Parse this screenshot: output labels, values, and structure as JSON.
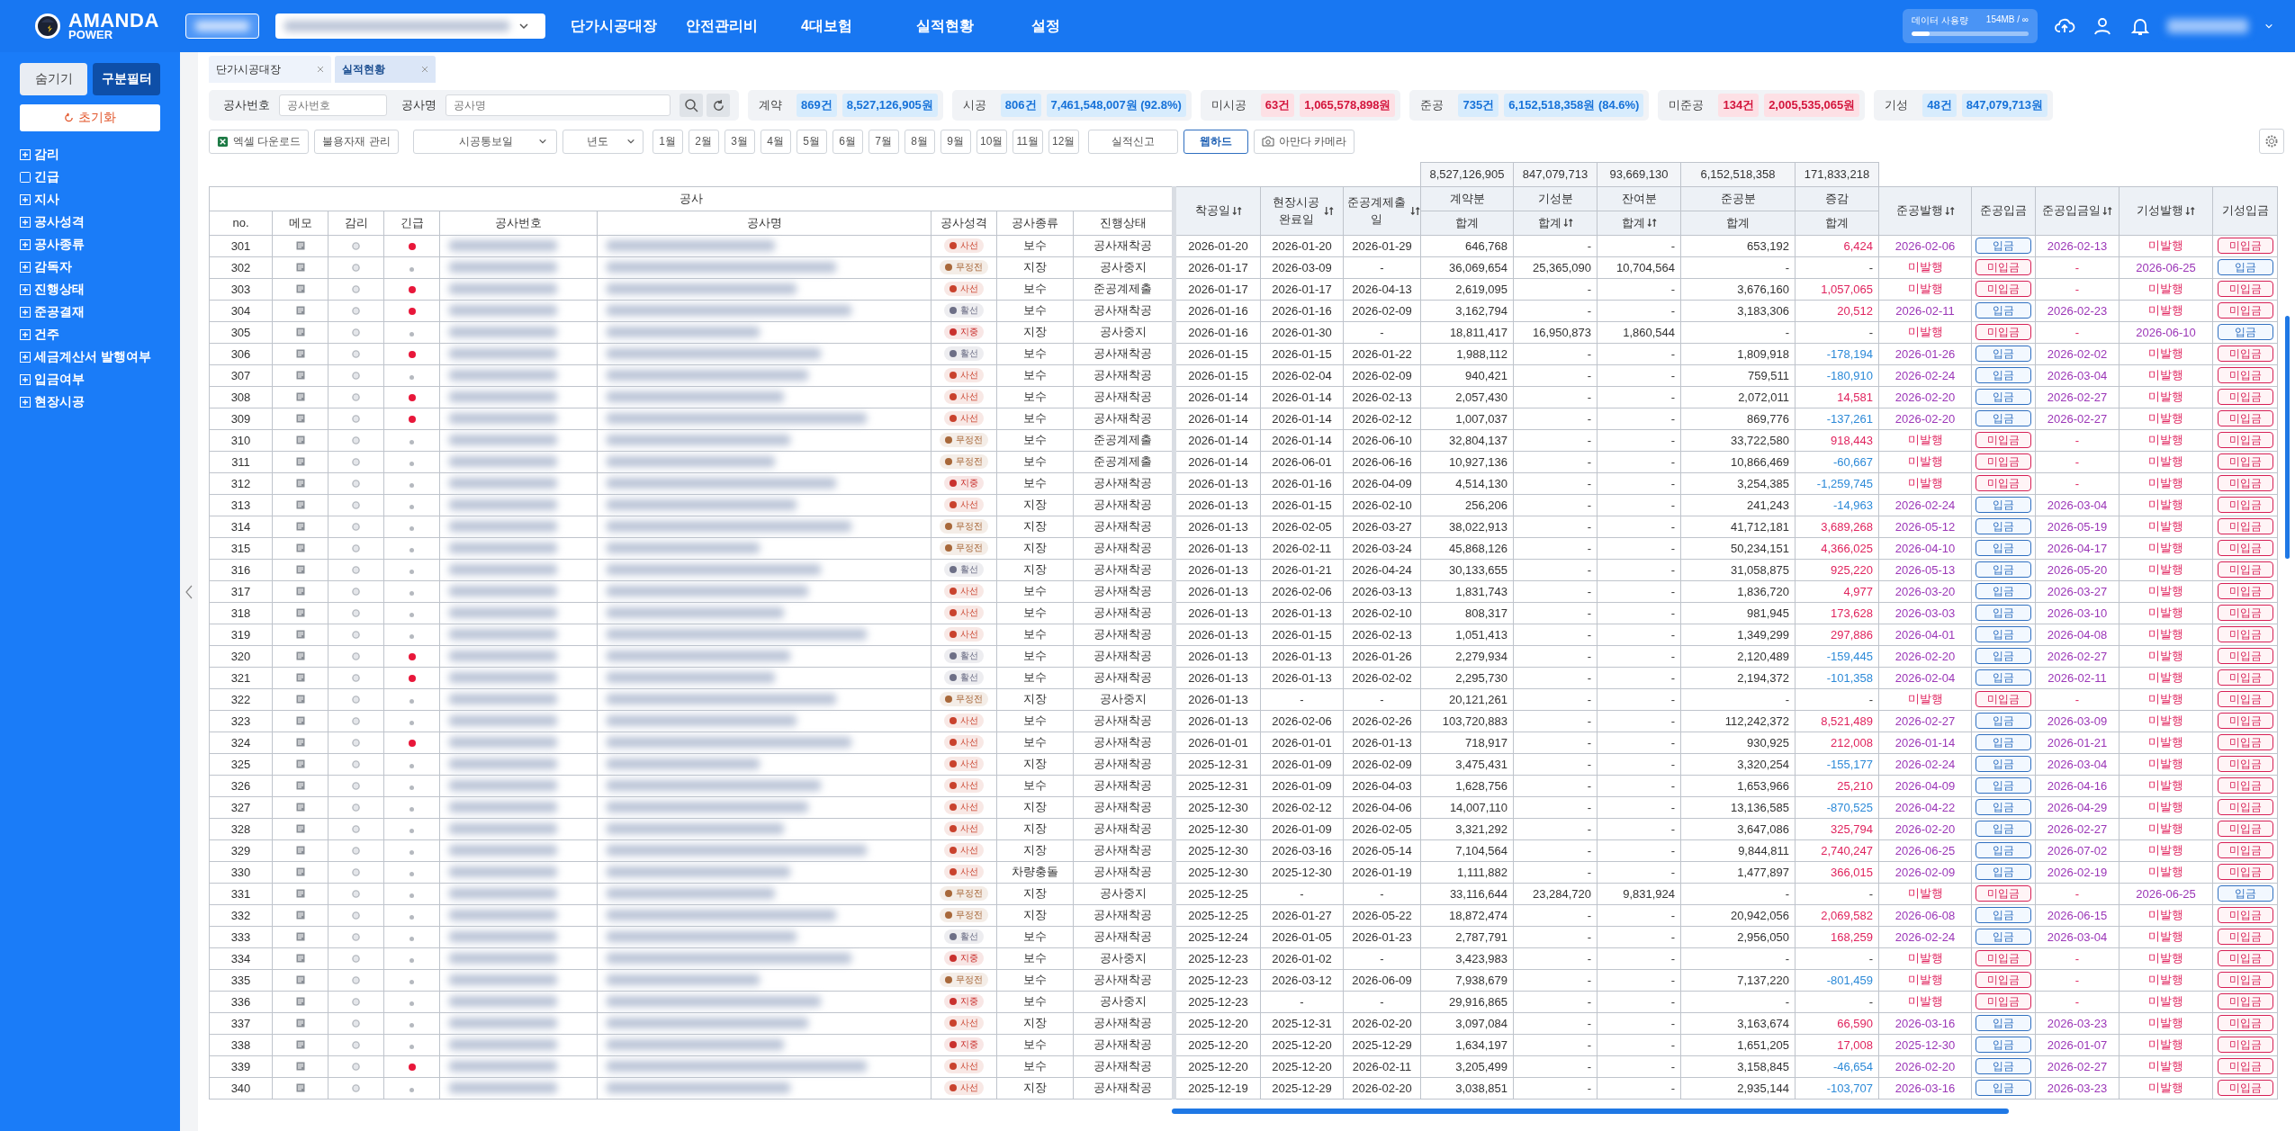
{
  "header": {
    "logo_title": "AMANDA",
    "logo_subtitle": "POWER",
    "nav": [
      "단가시공대장",
      "안전관리비",
      "4대보험",
      "실적현황",
      "설정"
    ],
    "usage": {
      "label": "데이터 사용량",
      "value": "154MB / ∞",
      "level": 0.15
    }
  },
  "sidebar": {
    "buttons": [
      {
        "label": "숨기기",
        "selected": false
      },
      {
        "label": "구분필터",
        "selected": true
      }
    ],
    "reset": "초기화",
    "items": [
      {
        "label": "감리",
        "kind": "group"
      },
      {
        "label": "긴급",
        "kind": "checkbox",
        "checked": false
      },
      {
        "label": "지사",
        "kind": "group"
      },
      {
        "label": "공사성격",
        "kind": "group"
      },
      {
        "label": "공사종류",
        "kind": "group"
      },
      {
        "label": "감독자",
        "kind": "group"
      },
      {
        "label": "진행상태",
        "kind": "group"
      },
      {
        "label": "준공결재",
        "kind": "group"
      },
      {
        "label": "건주",
        "kind": "group"
      },
      {
        "label": "세금계산서 발행여부",
        "kind": "group"
      },
      {
        "label": "입금여부",
        "kind": "group"
      },
      {
        "label": "현장시공",
        "kind": "group"
      }
    ]
  },
  "tabs": [
    {
      "label": "단가시공대장",
      "selected": false
    },
    {
      "label": "실적현황",
      "selected": true
    }
  ],
  "search": {
    "fields": [
      {
        "label": "공사번호",
        "placeholder": "공사번호"
      },
      {
        "label": "공사명",
        "placeholder": "공사명"
      }
    ]
  },
  "stats": [
    {
      "label": "계약",
      "count": "869건",
      "amount": "8,527,126,905원",
      "alert": false
    },
    {
      "label": "시공",
      "count": "806건",
      "amount": "7,461,548,007원 (92.8%)",
      "alert": false
    },
    {
      "label": "미시공",
      "count": "63건",
      "amount": "1,065,578,898원",
      "alert": true
    },
    {
      "label": "준공",
      "count": "735건",
      "amount": "6,152,518,358원 (84.6%)",
      "alert": false
    },
    {
      "label": "미준공",
      "count": "134건",
      "amount": "2,005,535,065원",
      "alert": true
    },
    {
      "label": "기성",
      "count": "48건",
      "amount": "847,079,713원",
      "alert": false
    }
  ],
  "toolbar": {
    "excel": "엑셀 다운로드",
    "materials": "불용자재 관리",
    "date_select": "시공통보일",
    "year_select": "년도",
    "months": [
      "1월",
      "2월",
      "3월",
      "4월",
      "5월",
      "6월",
      "7월",
      "8월",
      "9월",
      "10월",
      "11월",
      "12월"
    ],
    "report": "실적신고",
    "webhard": "웹하드",
    "camera": "아만다 카메라"
  },
  "table": {
    "group_label": "공사",
    "left_columns": [
      "no.",
      "메모",
      "감리",
      "긴급",
      "공사번호",
      "공사명",
      "공사성격",
      "공사종류",
      "진행상태"
    ],
    "date_columns": [
      {
        "label": "착공일",
        "sortable": true
      },
      {
        "label": "현장시공 완료일",
        "sortable": true
      },
      {
        "label": "준공계제출일",
        "sortable": true
      }
    ],
    "amount_columns": [
      {
        "label": "계약분",
        "total": "8,527,126,905",
        "sub_label": "합계",
        "sortable": false
      },
      {
        "label": "기성분",
        "total": "847,079,713",
        "sub_label": "합계",
        "sortable": true
      },
      {
        "label": "잔여분",
        "total": "93,669,130",
        "sub_label": "합계",
        "sortable": true
      },
      {
        "label": "준공분",
        "total": "6,152,518,358",
        "sub_label": "합계",
        "sortable": false
      },
      {
        "label": "증감",
        "total": "171,833,218",
        "sub_label": "합계",
        "sortable": false
      }
    ],
    "status_columns": [
      {
        "label": "준공발행",
        "sortable": true
      },
      {
        "label": "준공입금",
        "sortable": false
      },
      {
        "label": "준공입금일",
        "sortable": true
      },
      {
        "label": "기성발행",
        "sortable": true
      },
      {
        "label": "기성입금",
        "sortable": false
      }
    ],
    "rows": [
      {
        "no": "301",
        "urgent": true,
        "nature": {
          "label": "사선",
          "color": "#c9422d"
        },
        "type": "보수",
        "status": "공사재착공",
        "start": "2026-01-20",
        "site_done": "2026-01-20",
        "report_date": "2026-01-29",
        "contract": "646,768",
        "progress_amt": "-",
        "remaining": "-",
        "completed_amt": "653,192",
        "change": {
          "text": "6,424",
          "kind": "increase"
        },
        "comp_issue": "2026-02-06",
        "comp_issued": true,
        "comp_deposit": "입금",
        "comp_deposited": true,
        "comp_deposit_date": "2026-02-13",
        "prog_issue": "미발행",
        "prog_issued": false,
        "prog_deposit": "미입금",
        "prog_deposited": false
      },
      {
        "no": "302",
        "urgent": false,
        "nature": {
          "label": "무정전",
          "color": "#a8683a"
        },
        "type": "지장",
        "status": "공사중지",
        "start": "2026-01-17",
        "site_done": "2026-03-09",
        "report_date": "-",
        "contract": "36,069,654",
        "progress_amt": "25,365,090",
        "remaining": "10,704,564",
        "completed_amt": "-",
        "change": {
          "text": "-",
          "kind": "none"
        },
        "comp_issue": "미발행",
        "comp_issued": false,
        "comp_deposit": "미입금",
        "comp_deposited": false,
        "comp_deposit_date": "-",
        "prog_issue": "2026-06-25",
        "prog_issued": true,
        "prog_deposit": "입금",
        "prog_deposited": true
      },
      {
        "no": "303",
        "urgent": true,
        "nature": {
          "label": "사선",
          "color": "#c9422d"
        },
        "type": "보수",
        "status": "준공계제출",
        "start": "2026-01-17",
        "site_done": "2026-01-17",
        "report_date": "2026-04-13",
        "contract": "2,619,095",
        "progress_amt": "-",
        "remaining": "-",
        "completed_amt": "3,676,160",
        "change": {
          "text": "1,057,065",
          "kind": "increase"
        },
        "comp_issue": "미발행",
        "comp_issued": false,
        "comp_deposit": "미입금",
        "comp_deposited": false,
        "comp_deposit_date": "-",
        "prog_issue": "미발행",
        "prog_issued": false,
        "prog_deposit": "미입금",
        "prog_deposited": false
      },
      {
        "no": "304",
        "urgent": true,
        "nature": {
          "label": "활선",
          "color": "#6d6f86"
        },
        "type": "보수",
        "status": "공사재착공",
        "start": "2026-01-16",
        "site_done": "2026-01-16",
        "report_date": "2026-02-09",
        "contract": "3,162,794",
        "progress_amt": "-",
        "remaining": "-",
        "completed_amt": "3,183,306",
        "change": {
          "text": "20,512",
          "kind": "increase"
        },
        "comp_issue": "2026-02-11",
        "comp_issued": true,
        "comp_deposit": "입금",
        "comp_deposited": true,
        "comp_deposit_date": "2026-02-23",
        "prog_issue": "미발행",
        "prog_issued": false,
        "prog_deposit": "미입금",
        "prog_deposited": false
      },
      {
        "no": "305",
        "urgent": false,
        "nature": {
          "label": "지중",
          "color": "#c9302d"
        },
        "type": "지장",
        "status": "공사중지",
        "start": "2026-01-16",
        "site_done": "2026-01-30",
        "report_date": "-",
        "contract": "18,811,417",
        "progress_amt": "16,950,873",
        "remaining": "1,860,544",
        "completed_amt": "-",
        "change": {
          "text": "-",
          "kind": "none"
        },
        "comp_issue": "미발행",
        "comp_issued": false,
        "comp_deposit": "미입금",
        "comp_deposited": false,
        "comp_deposit_date": "-",
        "prog_issue": "2026-06-10",
        "prog_issued": true,
        "prog_deposit": "입금",
        "prog_deposited": true
      },
      {
        "no": "306",
        "urgent": true,
        "nature": {
          "label": "활선",
          "color": "#6d6f86"
        },
        "type": "보수",
        "status": "공사재착공",
        "start": "2026-01-15",
        "site_done": "2026-01-15",
        "report_date": "2026-01-22",
        "contract": "1,988,112",
        "progress_amt": "-",
        "remaining": "-",
        "completed_amt": "1,809,918",
        "change": {
          "text": "-178,194",
          "kind": "decrease"
        },
        "comp_issue": "2026-01-26",
        "comp_issued": true,
        "comp_deposit": "입금",
        "comp_deposited": true,
        "comp_deposit_date": "2026-02-02",
        "prog_issue": "미발행",
        "prog_issued": false,
        "prog_deposit": "미입금",
        "prog_deposited": false
      },
      {
        "no": "307",
        "urgent": false,
        "nature": {
          "label": "사선",
          "color": "#c9422d"
        },
        "type": "보수",
        "status": "공사재착공",
        "start": "2026-01-15",
        "site_done": "2026-02-04",
        "report_date": "2026-02-09",
        "contract": "940,421",
        "progress_amt": "-",
        "remaining": "-",
        "completed_amt": "759,511",
        "change": {
          "text": "-180,910",
          "kind": "decrease"
        },
        "comp_issue": "2026-02-24",
        "comp_issued": true,
        "comp_deposit": "입금",
        "comp_deposited": true,
        "comp_deposit_date": "2026-03-04",
        "prog_issue": "미발행",
        "prog_issued": false,
        "prog_deposit": "미입금",
        "prog_deposited": false
      },
      {
        "no": "308",
        "urgent": true,
        "nature": {
          "label": "사선",
          "color": "#c9422d"
        },
        "type": "보수",
        "status": "공사재착공",
        "start": "2026-01-14",
        "site_done": "2026-01-14",
        "report_date": "2026-02-13",
        "contract": "2,057,430",
        "progress_amt": "-",
        "remaining": "-",
        "completed_amt": "2,072,011",
        "change": {
          "text": "14,581",
          "kind": "increase"
        },
        "comp_issue": "2026-02-20",
        "comp_issued": true,
        "comp_deposit": "입금",
        "comp_deposited": true,
        "comp_deposit_date": "2026-02-27",
        "prog_issue": "미발행",
        "prog_issued": false,
        "prog_deposit": "미입금",
        "prog_deposited": false
      },
      {
        "no": "309",
        "urgent": true,
        "nature": {
          "label": "사선",
          "color": "#c9422d"
        },
        "type": "보수",
        "status": "공사재착공",
        "start": "2026-01-14",
        "site_done": "2026-01-14",
        "report_date": "2026-02-12",
        "contract": "1,007,037",
        "progress_amt": "-",
        "remaining": "-",
        "completed_amt": "869,776",
        "change": {
          "text": "-137,261",
          "kind": "decrease"
        },
        "comp_issue": "2026-02-20",
        "comp_issued": true,
        "comp_deposit": "입금",
        "comp_deposited": true,
        "comp_deposit_date": "2026-02-27",
        "prog_issue": "미발행",
        "prog_issued": false,
        "prog_deposit": "미입금",
        "prog_deposited": false
      },
      {
        "no": "310",
        "urgent": false,
        "nature": {
          "label": "무정전",
          "color": "#a8683a"
        },
        "type": "보수",
        "status": "준공계제출",
        "start": "2026-01-14",
        "site_done": "2026-01-14",
        "report_date": "2026-06-10",
        "contract": "32,804,137",
        "progress_amt": "-",
        "remaining": "-",
        "completed_amt": "33,722,580",
        "change": {
          "text": "918,443",
          "kind": "increase"
        },
        "comp_issue": "미발행",
        "comp_issued": false,
        "comp_deposit": "미입금",
        "comp_deposited": false,
        "comp_deposit_date": "-",
        "prog_issue": "미발행",
        "prog_issued": false,
        "prog_deposit": "미입금",
        "prog_deposited": false
      },
      {
        "no": "311",
        "urgent": false,
        "nature": {
          "label": "무정전",
          "color": "#a8683a"
        },
        "type": "보수",
        "status": "준공계제출",
        "start": "2026-01-14",
        "site_done": "2026-06-01",
        "report_date": "2026-06-16",
        "contract": "10,927,136",
        "progress_amt": "-",
        "remaining": "-",
        "completed_amt": "10,866,469",
        "change": {
          "text": "-60,667",
          "kind": "decrease"
        },
        "comp_issue": "미발행",
        "comp_issued": false,
        "comp_deposit": "미입금",
        "comp_deposited": false,
        "comp_deposit_date": "-",
        "prog_issue": "미발행",
        "prog_issued": false,
        "prog_deposit": "미입금",
        "prog_deposited": false
      },
      {
        "no": "312",
        "urgent": false,
        "nature": {
          "label": "지중",
          "color": "#c9302d"
        },
        "type": "보수",
        "status": "공사재착공",
        "start": "2026-01-13",
        "site_done": "2026-01-16",
        "report_date": "2026-04-09",
        "contract": "4,514,130",
        "progress_amt": "-",
        "remaining": "-",
        "completed_amt": "3,254,385",
        "change": {
          "text": "-1,259,745",
          "kind": "decrease"
        },
        "comp_issue": "미발행",
        "comp_issued": false,
        "comp_deposit": "미입금",
        "comp_deposited": false,
        "comp_deposit_date": "-",
        "prog_issue": "미발행",
        "prog_issued": false,
        "prog_deposit": "미입금",
        "prog_deposited": false
      },
      {
        "no": "313",
        "urgent": false,
        "nature": {
          "label": "사선",
          "color": "#c9422d"
        },
        "type": "지장",
        "status": "공사재착공",
        "start": "2026-01-13",
        "site_done": "2026-01-15",
        "report_date": "2026-02-10",
        "contract": "256,206",
        "progress_amt": "-",
        "remaining": "-",
        "completed_amt": "241,243",
        "change": {
          "text": "-14,963",
          "kind": "decrease"
        },
        "comp_issue": "2026-02-24",
        "comp_issued": true,
        "comp_deposit": "입금",
        "comp_deposited": true,
        "comp_deposit_date": "2026-03-04",
        "prog_issue": "미발행",
        "prog_issued": false,
        "prog_deposit": "미입금",
        "prog_deposited": false
      },
      {
        "no": "314",
        "urgent": false,
        "nature": {
          "label": "무정전",
          "color": "#a8683a"
        },
        "type": "지장",
        "status": "공사재착공",
        "start": "2026-01-13",
        "site_done": "2026-02-05",
        "report_date": "2026-03-27",
        "contract": "38,022,913",
        "progress_amt": "-",
        "remaining": "-",
        "completed_amt": "41,712,181",
        "change": {
          "text": "3,689,268",
          "kind": "increase"
        },
        "comp_issue": "2026-05-12",
        "comp_issued": true,
        "comp_deposit": "입금",
        "comp_deposited": true,
        "comp_deposit_date": "2026-05-19",
        "prog_issue": "미발행",
        "prog_issued": false,
        "prog_deposit": "미입금",
        "prog_deposited": false
      },
      {
        "no": "315",
        "urgent": false,
        "nature": {
          "label": "무정전",
          "color": "#a8683a"
        },
        "type": "지장",
        "status": "공사재착공",
        "start": "2026-01-13",
        "site_done": "2026-02-11",
        "report_date": "2026-03-24",
        "contract": "45,868,126",
        "progress_amt": "-",
        "remaining": "-",
        "completed_amt": "50,234,151",
        "change": {
          "text": "4,366,025",
          "kind": "increase"
        },
        "comp_issue": "2026-04-10",
        "comp_issued": true,
        "comp_deposit": "입금",
        "comp_deposited": true,
        "comp_deposit_date": "2026-04-17",
        "prog_issue": "미발행",
        "prog_issued": false,
        "prog_deposit": "미입금",
        "prog_deposited": false
      },
      {
        "no": "316",
        "urgent": false,
        "nature": {
          "label": "활선",
          "color": "#6d6f86"
        },
        "type": "지장",
        "status": "공사재착공",
        "start": "2026-01-13",
        "site_done": "2026-01-21",
        "report_date": "2026-04-24",
        "contract": "30,133,655",
        "progress_amt": "-",
        "remaining": "-",
        "completed_amt": "31,058,875",
        "change": {
          "text": "925,220",
          "kind": "increase"
        },
        "comp_issue": "2026-05-13",
        "comp_issued": true,
        "comp_deposit": "입금",
        "comp_deposited": true,
        "comp_deposit_date": "2026-05-20",
        "prog_issue": "미발행",
        "prog_issued": false,
        "prog_deposit": "미입금",
        "prog_deposited": false
      },
      {
        "no": "317",
        "urgent": false,
        "nature": {
          "label": "사선",
          "color": "#c9422d"
        },
        "type": "보수",
        "status": "공사재착공",
        "start": "2026-01-13",
        "site_done": "2026-02-06",
        "report_date": "2026-03-13",
        "contract": "1,831,743",
        "progress_amt": "-",
        "remaining": "-",
        "completed_amt": "1,836,720",
        "change": {
          "text": "4,977",
          "kind": "increase"
        },
        "comp_issue": "2026-03-20",
        "comp_issued": true,
        "comp_deposit": "입금",
        "comp_deposited": true,
        "comp_deposit_date": "2026-03-27",
        "prog_issue": "미발행",
        "prog_issued": false,
        "prog_deposit": "미입금",
        "prog_deposited": false
      },
      {
        "no": "318",
        "urgent": false,
        "nature": {
          "label": "사선",
          "color": "#c9422d"
        },
        "type": "보수",
        "status": "공사재착공",
        "start": "2026-01-13",
        "site_done": "2026-01-13",
        "report_date": "2026-02-10",
        "contract": "808,317",
        "progress_amt": "-",
        "remaining": "-",
        "completed_amt": "981,945",
        "change": {
          "text": "173,628",
          "kind": "increase"
        },
        "comp_issue": "2026-03-03",
        "comp_issued": true,
        "comp_deposit": "입금",
        "comp_deposited": true,
        "comp_deposit_date": "2026-03-10",
        "prog_issue": "미발행",
        "prog_issued": false,
        "prog_deposit": "미입금",
        "prog_deposited": false
      },
      {
        "no": "319",
        "urgent": false,
        "nature": {
          "label": "사선",
          "color": "#c9422d"
        },
        "type": "보수",
        "status": "공사재착공",
        "start": "2026-01-13",
        "site_done": "2026-01-15",
        "report_date": "2026-02-13",
        "contract": "1,051,413",
        "progress_amt": "-",
        "remaining": "-",
        "completed_amt": "1,349,299",
        "change": {
          "text": "297,886",
          "kind": "increase"
        },
        "comp_issue": "2026-04-01",
        "comp_issued": true,
        "comp_deposit": "입금",
        "comp_deposited": true,
        "comp_deposit_date": "2026-04-08",
        "prog_issue": "미발행",
        "prog_issued": false,
        "prog_deposit": "미입금",
        "prog_deposited": false
      },
      {
        "no": "320",
        "urgent": true,
        "nature": {
          "label": "활선",
          "color": "#6d6f86"
        },
        "type": "보수",
        "status": "공사재착공",
        "start": "2026-01-13",
        "site_done": "2026-01-13",
        "report_date": "2026-01-26",
        "contract": "2,279,934",
        "progress_amt": "-",
        "remaining": "-",
        "completed_amt": "2,120,489",
        "change": {
          "text": "-159,445",
          "kind": "decrease"
        },
        "comp_issue": "2026-02-20",
        "comp_issued": true,
        "comp_deposit": "입금",
        "comp_deposited": true,
        "comp_deposit_date": "2026-02-27",
        "prog_issue": "미발행",
        "prog_issued": false,
        "prog_deposit": "미입금",
        "prog_deposited": false
      },
      {
        "no": "321",
        "urgent": true,
        "nature": {
          "label": "활선",
          "color": "#6d6f86"
        },
        "type": "보수",
        "status": "공사재착공",
        "start": "2026-01-13",
        "site_done": "2026-01-13",
        "report_date": "2026-02-02",
        "contract": "2,295,730",
        "progress_amt": "-",
        "remaining": "-",
        "completed_amt": "2,194,372",
        "change": {
          "text": "-101,358",
          "kind": "decrease"
        },
        "comp_issue": "2026-02-04",
        "comp_issued": true,
        "comp_deposit": "입금",
        "comp_deposited": true,
        "comp_deposit_date": "2026-02-11",
        "prog_issue": "미발행",
        "prog_issued": false,
        "prog_deposit": "미입금",
        "prog_deposited": false
      },
      {
        "no": "322",
        "urgent": false,
        "nature": {
          "label": "무정전",
          "color": "#a8683a"
        },
        "type": "지장",
        "status": "공사중지",
        "start": "2026-01-13",
        "site_done": "-",
        "report_date": "-",
        "contract": "20,121,261",
        "progress_amt": "-",
        "remaining": "-",
        "completed_amt": "-",
        "change": {
          "text": "-",
          "kind": "none"
        },
        "comp_issue": "미발행",
        "comp_issued": false,
        "comp_deposit": "미입금",
        "comp_deposited": false,
        "comp_deposit_date": "-",
        "prog_issue": "미발행",
        "prog_issued": false,
        "prog_deposit": "미입금",
        "prog_deposited": false
      },
      {
        "no": "323",
        "urgent": false,
        "nature": {
          "label": "사선",
          "color": "#c9422d"
        },
        "type": "보수",
        "status": "공사재착공",
        "start": "2026-01-13",
        "site_done": "2026-02-06",
        "report_date": "2026-02-26",
        "contract": "103,720,883",
        "progress_amt": "-",
        "remaining": "-",
        "completed_amt": "112,242,372",
        "change": {
          "text": "8,521,489",
          "kind": "increase"
        },
        "comp_issue": "2026-02-27",
        "comp_issued": true,
        "comp_deposit": "입금",
        "comp_deposited": true,
        "comp_deposit_date": "2026-03-09",
        "prog_issue": "미발행",
        "prog_issued": false,
        "prog_deposit": "미입금",
        "prog_deposited": false
      },
      {
        "no": "324",
        "urgent": true,
        "nature": {
          "label": "사선",
          "color": "#c9422d"
        },
        "type": "보수",
        "status": "공사재착공",
        "start": "2026-01-01",
        "site_done": "2026-01-01",
        "report_date": "2026-01-13",
        "contract": "718,917",
        "progress_amt": "-",
        "remaining": "-",
        "completed_amt": "930,925",
        "change": {
          "text": "212,008",
          "kind": "increase"
        },
        "comp_issue": "2026-01-14",
        "comp_issued": true,
        "comp_deposit": "입금",
        "comp_deposited": true,
        "comp_deposit_date": "2026-01-21",
        "prog_issue": "미발행",
        "prog_issued": false,
        "prog_deposit": "미입금",
        "prog_deposited": false
      },
      {
        "no": "325",
        "urgent": false,
        "nature": {
          "label": "사선",
          "color": "#c9422d"
        },
        "type": "지장",
        "status": "공사재착공",
        "start": "2025-12-31",
        "site_done": "2026-01-09",
        "report_date": "2026-02-09",
        "contract": "3,475,431",
        "progress_amt": "-",
        "remaining": "-",
        "completed_amt": "3,320,254",
        "change": {
          "text": "-155,177",
          "kind": "decrease"
        },
        "comp_issue": "2026-02-24",
        "comp_issued": true,
        "comp_deposit": "입금",
        "comp_deposited": true,
        "comp_deposit_date": "2026-03-04",
        "prog_issue": "미발행",
        "prog_issued": false,
        "prog_deposit": "미입금",
        "prog_deposited": false
      },
      {
        "no": "326",
        "urgent": false,
        "nature": {
          "label": "사선",
          "color": "#c9422d"
        },
        "type": "보수",
        "status": "공사재착공",
        "start": "2025-12-31",
        "site_done": "2026-01-09",
        "report_date": "2026-04-03",
        "contract": "1,628,756",
        "progress_amt": "-",
        "remaining": "-",
        "completed_amt": "1,653,966",
        "change": {
          "text": "25,210",
          "kind": "increase"
        },
        "comp_issue": "2026-04-09",
        "comp_issued": true,
        "comp_deposit": "입금",
        "comp_deposited": true,
        "comp_deposit_date": "2026-04-16",
        "prog_issue": "미발행",
        "prog_issued": false,
        "prog_deposit": "미입금",
        "prog_deposited": false
      },
      {
        "no": "327",
        "urgent": false,
        "nature": {
          "label": "사선",
          "color": "#c9422d"
        },
        "type": "지장",
        "status": "공사재착공",
        "start": "2025-12-30",
        "site_done": "2026-02-12",
        "report_date": "2026-04-06",
        "contract": "14,007,110",
        "progress_amt": "-",
        "remaining": "-",
        "completed_amt": "13,136,585",
        "change": {
          "text": "-870,525",
          "kind": "decrease"
        },
        "comp_issue": "2026-04-22",
        "comp_issued": true,
        "comp_deposit": "입금",
        "comp_deposited": true,
        "comp_deposit_date": "2026-04-29",
        "prog_issue": "미발행",
        "prog_issued": false,
        "prog_deposit": "미입금",
        "prog_deposited": false
      },
      {
        "no": "328",
        "urgent": false,
        "nature": {
          "label": "사선",
          "color": "#c9422d"
        },
        "type": "지장",
        "status": "공사재착공",
        "start": "2025-12-30",
        "site_done": "2026-01-09",
        "report_date": "2026-02-05",
        "contract": "3,321,292",
        "progress_amt": "-",
        "remaining": "-",
        "completed_amt": "3,647,086",
        "change": {
          "text": "325,794",
          "kind": "increase"
        },
        "comp_issue": "2026-02-20",
        "comp_issued": true,
        "comp_deposit": "입금",
        "comp_deposited": true,
        "comp_deposit_date": "2026-02-27",
        "prog_issue": "미발행",
        "prog_issued": false,
        "prog_deposit": "미입금",
        "prog_deposited": false
      },
      {
        "no": "329",
        "urgent": false,
        "nature": {
          "label": "사선",
          "color": "#c9422d"
        },
        "type": "지장",
        "status": "공사재착공",
        "start": "2025-12-30",
        "site_done": "2026-03-16",
        "report_date": "2026-05-14",
        "contract": "7,104,564",
        "progress_amt": "-",
        "remaining": "-",
        "completed_amt": "9,844,811",
        "change": {
          "text": "2,740,247",
          "kind": "increase"
        },
        "comp_issue": "2026-06-25",
        "comp_issued": true,
        "comp_deposit": "입금",
        "comp_deposited": true,
        "comp_deposit_date": "2026-07-02",
        "prog_issue": "미발행",
        "prog_issued": false,
        "prog_deposit": "미입금",
        "prog_deposited": false
      },
      {
        "no": "330",
        "urgent": false,
        "nature": {
          "label": "사선",
          "color": "#c9422d"
        },
        "type": "차량충돌",
        "status": "공사재착공",
        "start": "2025-12-30",
        "site_done": "2025-12-30",
        "report_date": "2026-01-19",
        "contract": "1,111,882",
        "progress_amt": "-",
        "remaining": "-",
        "completed_amt": "1,477,897",
        "change": {
          "text": "366,015",
          "kind": "increase"
        },
        "comp_issue": "2026-02-09",
        "comp_issued": true,
        "comp_deposit": "입금",
        "comp_deposited": true,
        "comp_deposit_date": "2026-02-19",
        "prog_issue": "미발행",
        "prog_issued": false,
        "prog_deposit": "미입금",
        "prog_deposited": false
      },
      {
        "no": "331",
        "urgent": false,
        "nature": {
          "label": "무정전",
          "color": "#a8683a"
        },
        "type": "지장",
        "status": "공사중지",
        "start": "2025-12-25",
        "site_done": "-",
        "report_date": "-",
        "contract": "33,116,644",
        "progress_amt": "23,284,720",
        "remaining": "9,831,924",
        "completed_amt": "-",
        "change": {
          "text": "-",
          "kind": "none"
        },
        "comp_issue": "미발행",
        "comp_issued": false,
        "comp_deposit": "미입금",
        "comp_deposited": false,
        "comp_deposit_date": "-",
        "prog_issue": "2026-06-25",
        "prog_issued": true,
        "prog_deposit": "입금",
        "prog_deposited": true
      },
      {
        "no": "332",
        "urgent": false,
        "nature": {
          "label": "무정전",
          "color": "#a8683a"
        },
        "type": "지장",
        "status": "공사재착공",
        "start": "2025-12-25",
        "site_done": "2026-01-27",
        "report_date": "2026-05-22",
        "contract": "18,872,474",
        "progress_amt": "-",
        "remaining": "-",
        "completed_amt": "20,942,056",
        "change": {
          "text": "2,069,582",
          "kind": "increase"
        },
        "comp_issue": "2026-06-08",
        "comp_issued": true,
        "comp_deposit": "입금",
        "comp_deposited": true,
        "comp_deposit_date": "2026-06-15",
        "prog_issue": "미발행",
        "prog_issued": false,
        "prog_deposit": "미입금",
        "prog_deposited": false
      },
      {
        "no": "333",
        "urgent": false,
        "nature": {
          "label": "활선",
          "color": "#6d6f86"
        },
        "type": "보수",
        "status": "공사재착공",
        "start": "2025-12-24",
        "site_done": "2026-01-05",
        "report_date": "2026-01-23",
        "contract": "2,787,791",
        "progress_amt": "-",
        "remaining": "-",
        "completed_amt": "2,956,050",
        "change": {
          "text": "168,259",
          "kind": "increase"
        },
        "comp_issue": "2026-02-24",
        "comp_issued": true,
        "comp_deposit": "입금",
        "comp_deposited": true,
        "comp_deposit_date": "2026-03-04",
        "prog_issue": "미발행",
        "prog_issued": false,
        "prog_deposit": "미입금",
        "prog_deposited": false
      },
      {
        "no": "334",
        "urgent": false,
        "nature": {
          "label": "지중",
          "color": "#c9302d"
        },
        "type": "보수",
        "status": "공사중지",
        "start": "2025-12-23",
        "site_done": "2026-01-02",
        "report_date": "-",
        "contract": "3,423,983",
        "progress_amt": "-",
        "remaining": "-",
        "completed_amt": "-",
        "change": {
          "text": "-",
          "kind": "none"
        },
        "comp_issue": "미발행",
        "comp_issued": false,
        "comp_deposit": "미입금",
        "comp_deposited": false,
        "comp_deposit_date": "-",
        "prog_issue": "미발행",
        "prog_issued": false,
        "prog_deposit": "미입금",
        "prog_deposited": false
      },
      {
        "no": "335",
        "urgent": false,
        "nature": {
          "label": "무정전",
          "color": "#a8683a"
        },
        "type": "보수",
        "status": "공사재착공",
        "start": "2025-12-23",
        "site_done": "2026-03-12",
        "report_date": "2026-06-09",
        "contract": "7,938,679",
        "progress_amt": "-",
        "remaining": "-",
        "completed_amt": "7,137,220",
        "change": {
          "text": "-801,459",
          "kind": "decrease"
        },
        "comp_issue": "미발행",
        "comp_issued": false,
        "comp_deposit": "미입금",
        "comp_deposited": false,
        "comp_deposit_date": "-",
        "prog_issue": "미발행",
        "prog_issued": false,
        "prog_deposit": "미입금",
        "prog_deposited": false
      },
      {
        "no": "336",
        "urgent": false,
        "nature": {
          "label": "지중",
          "color": "#c9302d"
        },
        "type": "보수",
        "status": "공사중지",
        "start": "2025-12-23",
        "site_done": "-",
        "report_date": "-",
        "contract": "29,916,865",
        "progress_amt": "-",
        "remaining": "-",
        "completed_amt": "-",
        "change": {
          "text": "-",
          "kind": "none"
        },
        "comp_issue": "미발행",
        "comp_issued": false,
        "comp_deposit": "미입금",
        "comp_deposited": false,
        "comp_deposit_date": "-",
        "prog_issue": "미발행",
        "prog_issued": false,
        "prog_deposit": "미입금",
        "prog_deposited": false
      },
      {
        "no": "337",
        "urgent": false,
        "nature": {
          "label": "사선",
          "color": "#c9422d"
        },
        "type": "지장",
        "status": "공사재착공",
        "start": "2025-12-20",
        "site_done": "2025-12-31",
        "report_date": "2026-02-20",
        "contract": "3,097,084",
        "progress_amt": "-",
        "remaining": "-",
        "completed_amt": "3,163,674",
        "change": {
          "text": "66,590",
          "kind": "increase"
        },
        "comp_issue": "2026-03-16",
        "comp_issued": true,
        "comp_deposit": "입금",
        "comp_deposited": true,
        "comp_deposit_date": "2026-03-23",
        "prog_issue": "미발행",
        "prog_issued": false,
        "prog_deposit": "미입금",
        "prog_deposited": false
      },
      {
        "no": "338",
        "urgent": false,
        "nature": {
          "label": "지중",
          "color": "#c9302d"
        },
        "type": "보수",
        "status": "공사재착공",
        "start": "2025-12-20",
        "site_done": "2025-12-20",
        "report_date": "2025-12-29",
        "contract": "1,634,197",
        "progress_amt": "-",
        "remaining": "-",
        "completed_amt": "1,651,205",
        "change": {
          "text": "17,008",
          "kind": "increase"
        },
        "comp_issue": "2025-12-30",
        "comp_issued": true,
        "comp_deposit": "입금",
        "comp_deposited": true,
        "comp_deposit_date": "2026-01-07",
        "prog_issue": "미발행",
        "prog_issued": false,
        "prog_deposit": "미입금",
        "prog_deposited": false
      },
      {
        "no": "339",
        "urgent": true,
        "nature": {
          "label": "사선",
          "color": "#c9422d"
        },
        "type": "보수",
        "status": "공사재착공",
        "start": "2025-12-20",
        "site_done": "2025-12-20",
        "report_date": "2026-02-11",
        "contract": "3,205,499",
        "progress_amt": "-",
        "remaining": "-",
        "completed_amt": "3,158,845",
        "change": {
          "text": "-46,654",
          "kind": "decrease"
        },
        "comp_issue": "2026-02-20",
        "comp_issued": true,
        "comp_deposit": "입금",
        "comp_deposited": true,
        "comp_deposit_date": "2026-02-27",
        "prog_issue": "미발행",
        "prog_issued": false,
        "prog_deposit": "미입금",
        "prog_deposited": false
      },
      {
        "no": "340",
        "urgent": false,
        "nature": {
          "label": "사선",
          "color": "#c9422d"
        },
        "type": "지장",
        "status": "공사재착공",
        "start": "2025-12-19",
        "site_done": "2025-12-29",
        "report_date": "2026-02-20",
        "contract": "3,038,851",
        "progress_amt": "-",
        "remaining": "-",
        "completed_amt": "2,935,144",
        "change": {
          "text": "-103,707",
          "kind": "decrease"
        },
        "comp_issue": "2026-03-16",
        "comp_issued": true,
        "comp_deposit": "입금",
        "comp_deposited": true,
        "comp_deposit_date": "2026-03-23",
        "prog_issue": "미발행",
        "prog_issued": false,
        "prog_deposit": "미입금",
        "prog_deposited": false
      }
    ]
  }
}
